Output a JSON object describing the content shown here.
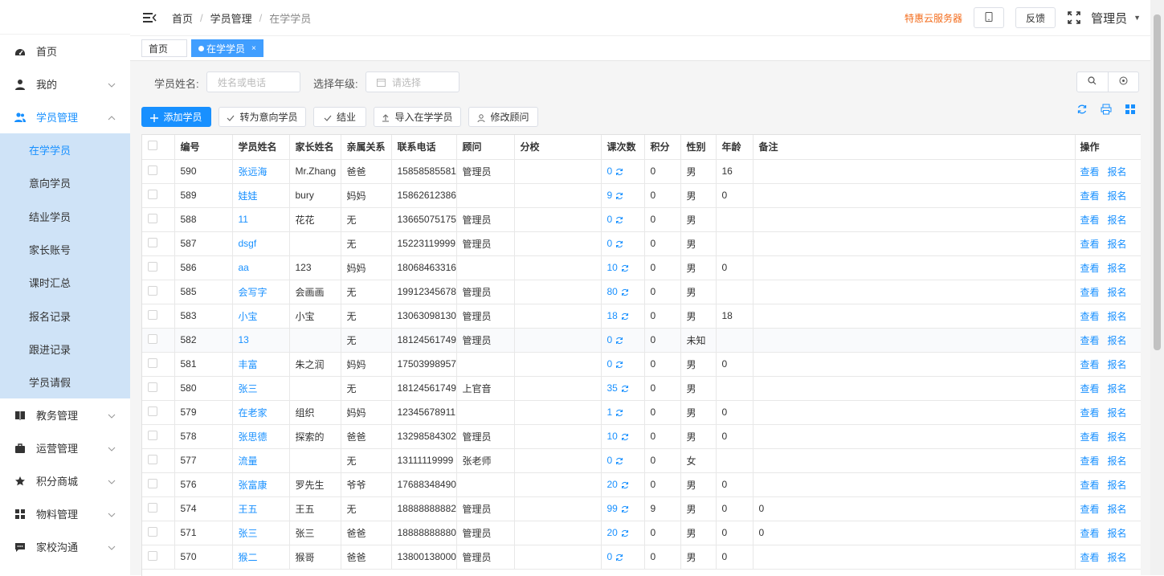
{
  "sidebar": {
    "menu": [
      {
        "label": "首页",
        "icon": "dashboard-icon",
        "expandable": false
      },
      {
        "label": "我的",
        "icon": "user-icon",
        "expandable": true
      },
      {
        "label": "学员管理",
        "icon": "users-icon",
        "expandable": true,
        "expanded": true
      }
    ],
    "submenu": [
      "在学学员",
      "意向学员",
      "结业学员",
      "家长账号",
      "课时汇总",
      "报名记录",
      "跟进记录",
      "学员请假"
    ],
    "active_sub": "在学学员",
    "menu_after": [
      {
        "label": "教务管理",
        "icon": "book-icon"
      },
      {
        "label": "运营管理",
        "icon": "briefcase-icon"
      },
      {
        "label": "积分商城",
        "icon": "star-icon"
      },
      {
        "label": "物料管理",
        "icon": "grid-icon"
      },
      {
        "label": "家校沟通",
        "icon": "chat-icon"
      }
    ]
  },
  "header": {
    "breadcrumb": [
      "首页",
      "学员管理",
      "在学学员"
    ],
    "promo": "特惠云服务器",
    "feedback": "反馈",
    "user": "管理员"
  },
  "tabs": {
    "home": "首页",
    "active": "在学学员"
  },
  "search": {
    "name_label": "学员姓名:",
    "name_placeholder": "姓名或电话",
    "grade_label": "选择年级:",
    "grade_placeholder": "请选择"
  },
  "toolbar": {
    "add": "添加学员",
    "to_intent": "转为意向学员",
    "graduate": "结业",
    "import": "导入在学学员",
    "change_advisor": "修改顾问"
  },
  "table": {
    "columns": [
      "编号",
      "学员姓名",
      "家长姓名",
      "亲属关系",
      "联系电话",
      "顾问",
      "分校",
      "课次数",
      "积分",
      "性别",
      "年龄",
      "备注",
      "操作"
    ],
    "actions": [
      "查看",
      "报名"
    ],
    "rows": [
      {
        "id": "590",
        "name": "张远海",
        "parent": "Mr.Zhang",
        "rel": "爸爸",
        "phone": "15858585581",
        "advisor": "管理员",
        "branch": "",
        "lessons": "0",
        "points": "0",
        "gender": "男",
        "age": "16",
        "note": ""
      },
      {
        "id": "589",
        "name": "娃娃",
        "parent": "bury",
        "rel": "妈妈",
        "phone": "15862612386",
        "advisor": "",
        "branch": "",
        "lessons": "9",
        "points": "0",
        "gender": "男",
        "age": "0",
        "note": ""
      },
      {
        "id": "588",
        "name": "11",
        "parent": "花花",
        "rel": "无",
        "phone": "13665075175",
        "advisor": "管理员",
        "branch": "",
        "lessons": "0",
        "points": "0",
        "gender": "男",
        "age": "",
        "note": ""
      },
      {
        "id": "587",
        "name": "dsgf",
        "parent": "",
        "rel": "无",
        "phone": "15223119999",
        "advisor": "管理员",
        "branch": "",
        "lessons": "0",
        "points": "0",
        "gender": "男",
        "age": "",
        "note": ""
      },
      {
        "id": "586",
        "name": "aa",
        "parent": "123",
        "rel": "妈妈",
        "phone": "18068463316",
        "advisor": "",
        "branch": "",
        "lessons": "10",
        "points": "0",
        "gender": "男",
        "age": "0",
        "note": ""
      },
      {
        "id": "585",
        "name": "会写字",
        "parent": "会画画",
        "rel": "无",
        "phone": "19912345678",
        "advisor": "管理员",
        "branch": "",
        "lessons": "80",
        "points": "0",
        "gender": "男",
        "age": "",
        "note": ""
      },
      {
        "id": "583",
        "name": "小宝",
        "parent": "小宝",
        "rel": "无",
        "phone": "13063098130",
        "advisor": "管理员",
        "branch": "",
        "lessons": "18",
        "points": "0",
        "gender": "男",
        "age": "18",
        "note": ""
      },
      {
        "id": "582",
        "name": "13",
        "parent": "",
        "rel": "无",
        "phone": "18124561749",
        "advisor": "管理员",
        "branch": "",
        "lessons": "0",
        "points": "0",
        "gender": "未知",
        "age": "",
        "note": ""
      },
      {
        "id": "581",
        "name": "丰富",
        "parent": "朱之润",
        "rel": "妈妈",
        "phone": "17503998957",
        "advisor": "",
        "branch": "",
        "lessons": "0",
        "points": "0",
        "gender": "男",
        "age": "0",
        "note": ""
      },
      {
        "id": "580",
        "name": "张三",
        "parent": "",
        "rel": "无",
        "phone": "18124561749",
        "advisor": "上官音",
        "branch": "",
        "lessons": "35",
        "points": "0",
        "gender": "男",
        "age": "",
        "note": ""
      },
      {
        "id": "579",
        "name": "在老家",
        "parent": "组织",
        "rel": "妈妈",
        "phone": "12345678911",
        "advisor": "",
        "branch": "",
        "lessons": "1",
        "points": "0",
        "gender": "男",
        "age": "0",
        "note": ""
      },
      {
        "id": "578",
        "name": "张思德",
        "parent": "探索的",
        "rel": "爸爸",
        "phone": "13298584302",
        "advisor": "管理员",
        "branch": "",
        "lessons": "10",
        "points": "0",
        "gender": "男",
        "age": "0",
        "note": ""
      },
      {
        "id": "577",
        "name": "流量",
        "parent": "",
        "rel": "无",
        "phone": "13111119999",
        "advisor": "张老师",
        "branch": "",
        "lessons": "0",
        "points": "0",
        "gender": "女",
        "age": "",
        "note": ""
      },
      {
        "id": "576",
        "name": "张富康",
        "parent": "罗先生",
        "rel": "爷爷",
        "phone": "17688348490",
        "advisor": "",
        "branch": "",
        "lessons": "20",
        "points": "0",
        "gender": "男",
        "age": "0",
        "note": ""
      },
      {
        "id": "574",
        "name": "王五",
        "parent": "王五",
        "rel": "无",
        "phone": "18888888882",
        "advisor": "管理员",
        "branch": "",
        "lessons": "99",
        "points": "9",
        "gender": "男",
        "age": "0",
        "note": "0"
      },
      {
        "id": "571",
        "name": "张三",
        "parent": "张三",
        "rel": "爸爸",
        "phone": "18888888880",
        "advisor": "管理员",
        "branch": "",
        "lessons": "20",
        "points": "0",
        "gender": "男",
        "age": "0",
        "note": "0"
      },
      {
        "id": "570",
        "name": "猴二",
        "parent": "猴哥",
        "rel": "爸爸",
        "phone": "13800138000",
        "advisor": "管理员",
        "branch": "",
        "lessons": "0",
        "points": "0",
        "gender": "男",
        "age": "0",
        "note": ""
      }
    ]
  }
}
